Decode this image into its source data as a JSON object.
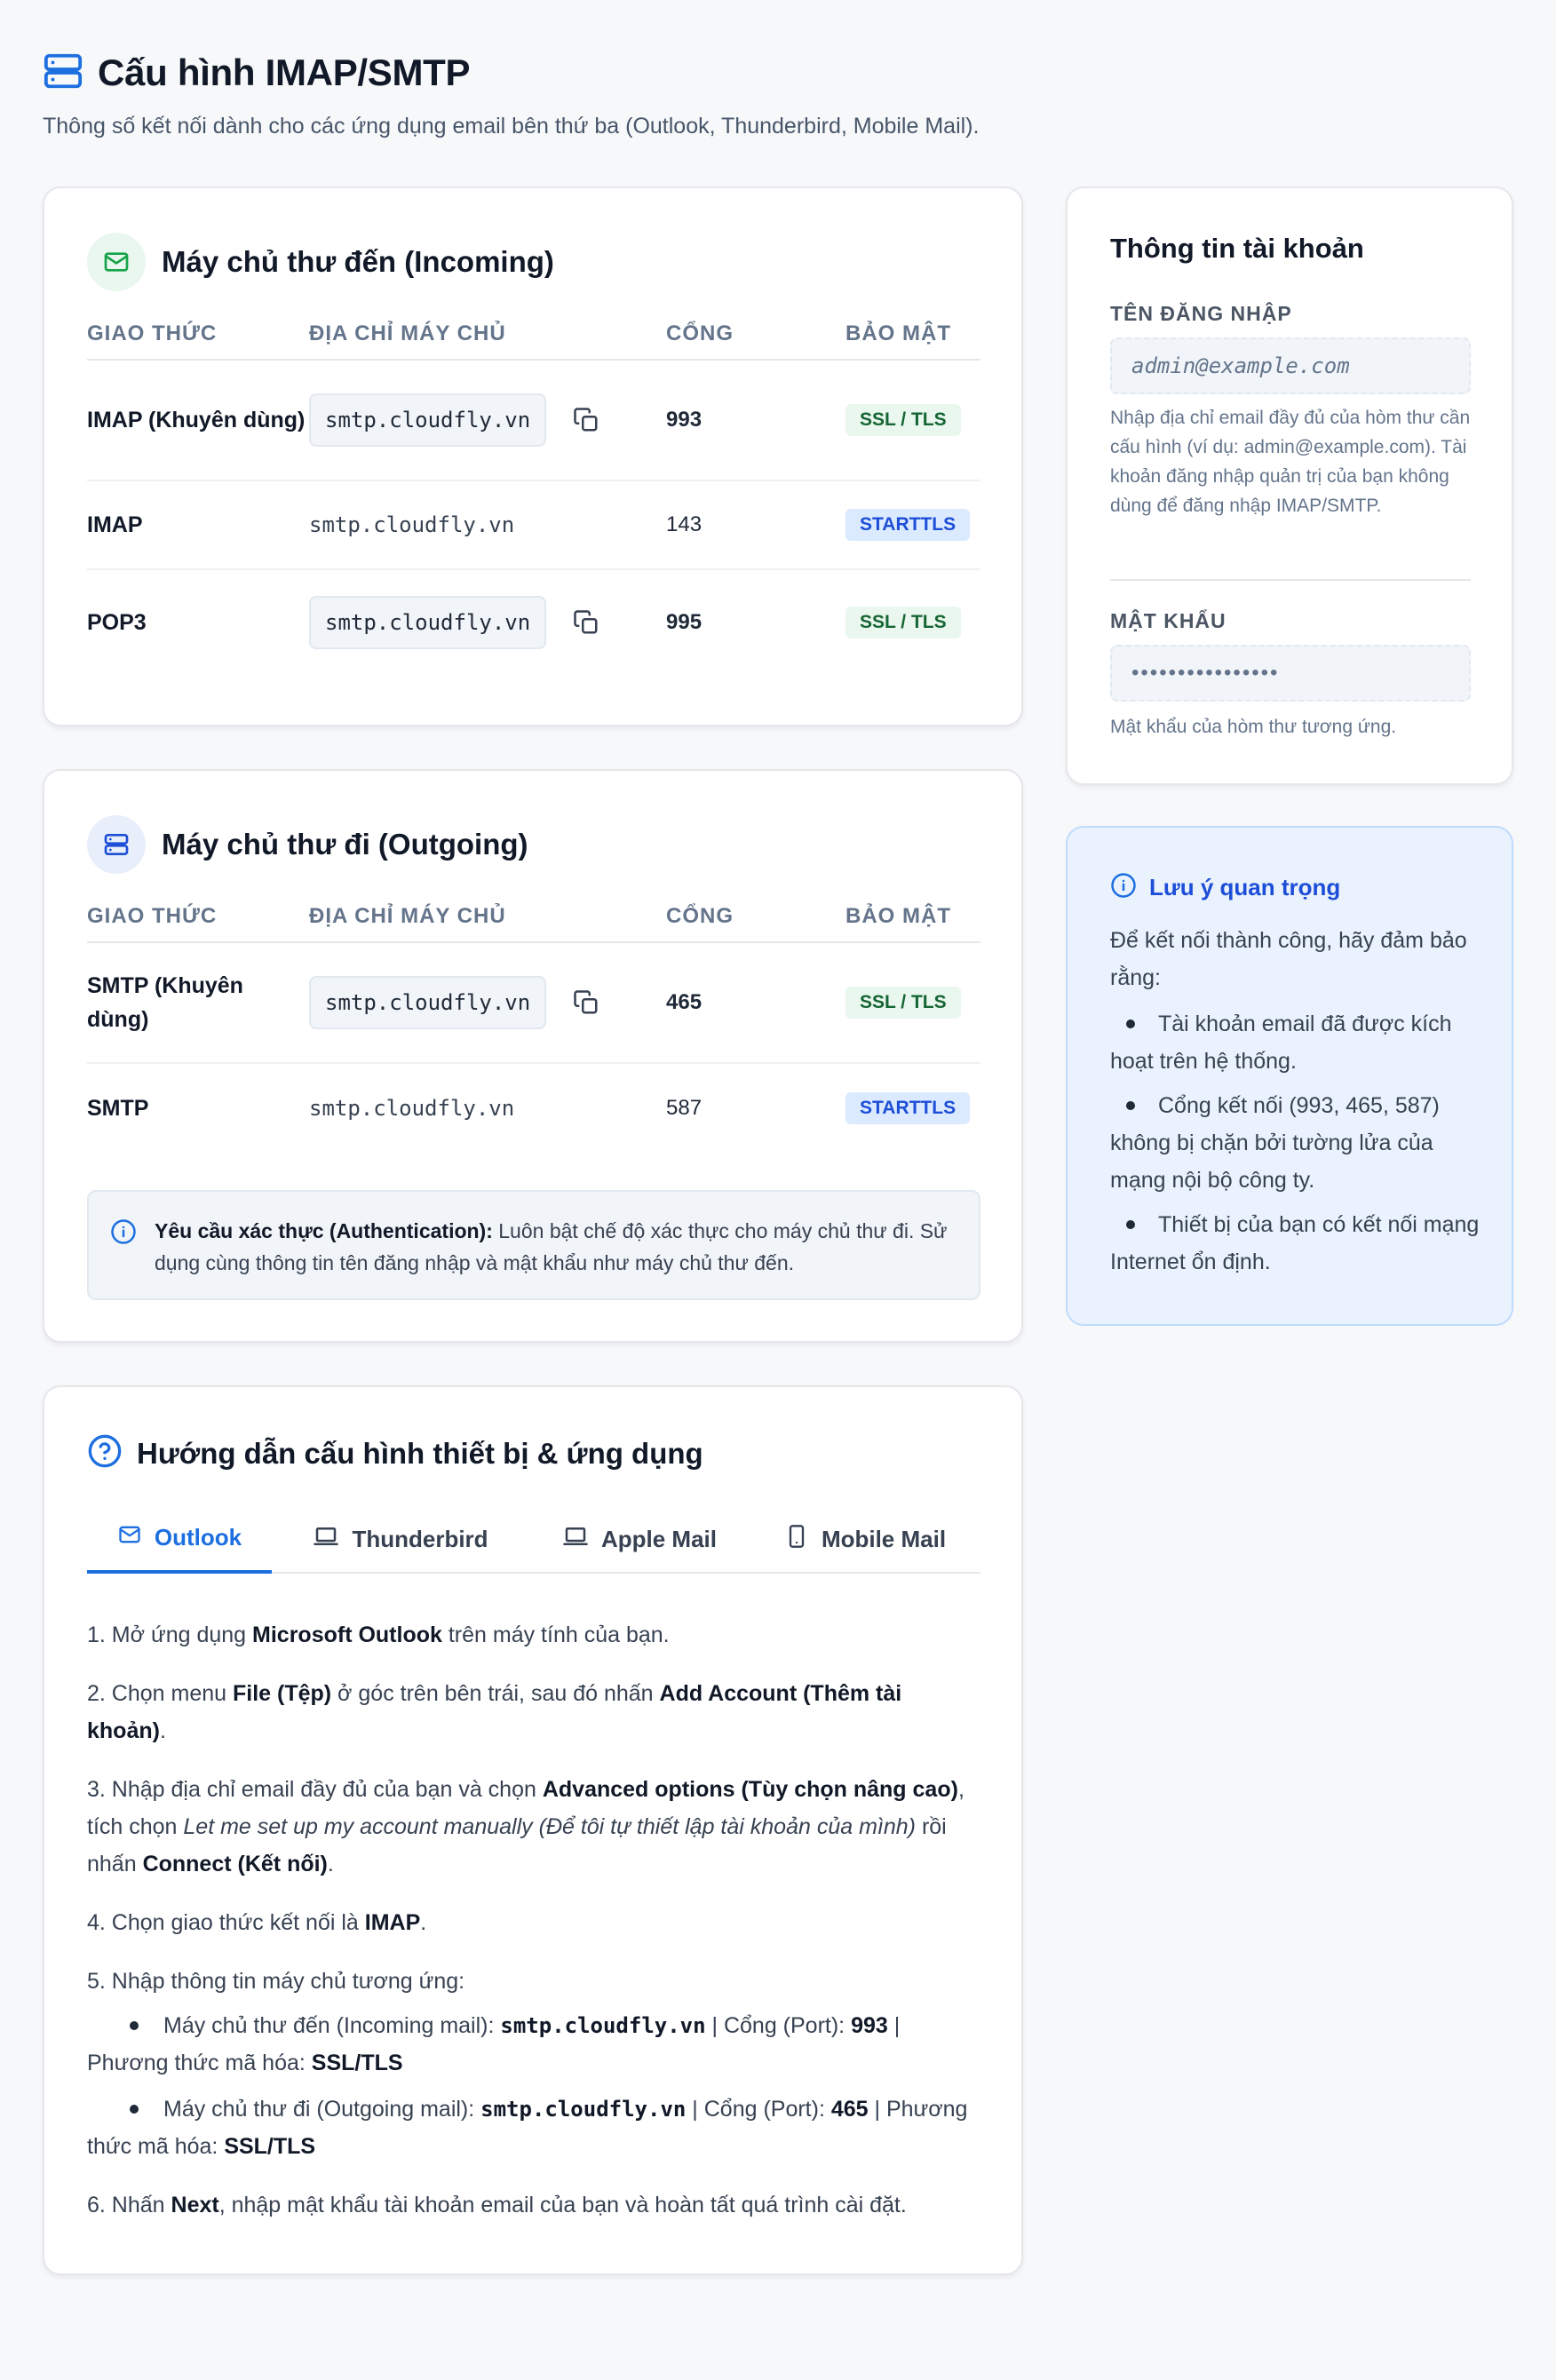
{
  "header": {
    "title": "Cấu hình IMAP/SMTP",
    "subtitle": "Thông số kết nối dành cho các ứng dụng email bên thứ ba (Outlook, Thunderbird, Mobile Mail)."
  },
  "table_headers": {
    "protocol": "GIAO THỨC",
    "address": "ĐỊA CHỈ MÁY CHỦ",
    "port": "CỔNG",
    "security": "BẢO MẬT"
  },
  "incoming": {
    "title": "Máy chủ thư đến (Incoming)",
    "rows": [
      {
        "protocol": "IMAP (Khuyên dùng)",
        "address": "smtp.cloudfly.vn",
        "port": "993",
        "security": "SSL / TLS"
      },
      {
        "protocol": "IMAP",
        "address": "smtp.cloudfly.vn",
        "port": "143",
        "security": "STARTTLS"
      },
      {
        "protocol": "POP3",
        "address": "smtp.cloudfly.vn",
        "port": "995",
        "security": "SSL / TLS"
      }
    ]
  },
  "outgoing": {
    "title": "Máy chủ thư đi (Outgoing)",
    "rows": [
      {
        "protocol": "SMTP (Khuyên dùng)",
        "address": "smtp.cloudfly.vn",
        "port": "465",
        "security": "SSL / TLS"
      },
      {
        "protocol": "SMTP",
        "address": "smtp.cloudfly.vn",
        "port": "587",
        "security": "STARTTLS"
      }
    ],
    "auth_note_label": "Yêu cầu xác thực (Authentication):",
    "auth_note_text": "Luôn bật chế độ xác thực cho máy chủ thư đi. Sử dụng cùng thông tin tên đăng nhập và mật khẩu như máy chủ thư đến."
  },
  "account": {
    "title": "Thông tin tài khoản",
    "username_label": "TÊN ĐĂNG NHẬP",
    "username_value": "admin@example.com",
    "username_help": "Nhập địa chỉ email đầy đủ của hòm thư cần cấu hình (ví dụ: admin@example.com). Tài khoản đăng nhập quản trị của bạn không dùng để đăng nhập IMAP/SMTP.",
    "password_label": "MẬT KHẨU",
    "password_value": "••••••••••••••••",
    "password_help": "Mật khẩu của hòm thư tương ứng."
  },
  "notice": {
    "title": "Lưu ý quan trọng",
    "intro": "Để kết nối thành công, hãy đảm bảo rằng:",
    "items": [
      "Tài khoản email đã được kích hoạt trên hệ thống.",
      "Cổng kết nối (993, 465, 587) không bị chặn bởi tường lửa của mạng nội bộ công ty.",
      "Thiết bị của bạn có kết nối mạng Internet ổn định."
    ]
  },
  "guide": {
    "title": "Hướng dẫn cấu hình thiết bị & ứng dụng",
    "tabs": [
      "Outlook",
      "Thunderbird",
      "Apple Mail",
      "Mobile Mail"
    ],
    "active_tab": "Outlook",
    "step1": {
      "a": "1. Mở ứng dụng ",
      "b": "Microsoft Outlook",
      "c": " trên máy tính của bạn."
    },
    "step2": {
      "a": "2. Chọn menu ",
      "b": "File (Tệp)",
      "c": " ở góc trên bên trái, sau đó nhấn ",
      "d": "Add Account (Thêm tài khoản)",
      "e": "."
    },
    "step3": {
      "a": "3. Nhập địa chỉ email đầy đủ của bạn và chọn ",
      "b": "Advanced options (Tùy chọn nâng cao)",
      "c": ", tích chọn ",
      "d": "Let me set up my account manually (Để tôi tự thiết lập tài khoản của mình)",
      "e": " rồi nhấn ",
      "f": "Connect (Kết nối)",
      "g": "."
    },
    "step4": {
      "a": "4. Chọn giao thức kết nối là ",
      "b": "IMAP",
      "c": "."
    },
    "step5": {
      "a": "5. Nhập thông tin máy chủ tương ứng:",
      "in": {
        "a": "Máy chủ thư đến (Incoming mail): ",
        "host": "smtp.cloudfly.vn",
        "b": " | Cổng (Port): ",
        "port": "993",
        "c": " | Phương thức mã hóa: ",
        "enc": "SSL/TLS"
      },
      "out": {
        "a": "Máy chủ thư đi (Outgoing mail): ",
        "host": "smtp.cloudfly.vn",
        "b": " | Cổng (Port): ",
        "port": "465",
        "c": " | Phương thức mã hóa: ",
        "enc": "SSL/TLS"
      }
    },
    "step6": {
      "a": "6. Nhấn ",
      "b": "Next",
      "c": ", nhập mật khẩu tài khoản email của bạn và hoàn tất quá trình cài đặt."
    }
  },
  "colors": {
    "accent": "#1d6fe0",
    "ssl_badge_bg": "#e9f7ee",
    "starttls_badge_bg": "#dbeafe",
    "notice_bg": "#eaf2fd"
  }
}
